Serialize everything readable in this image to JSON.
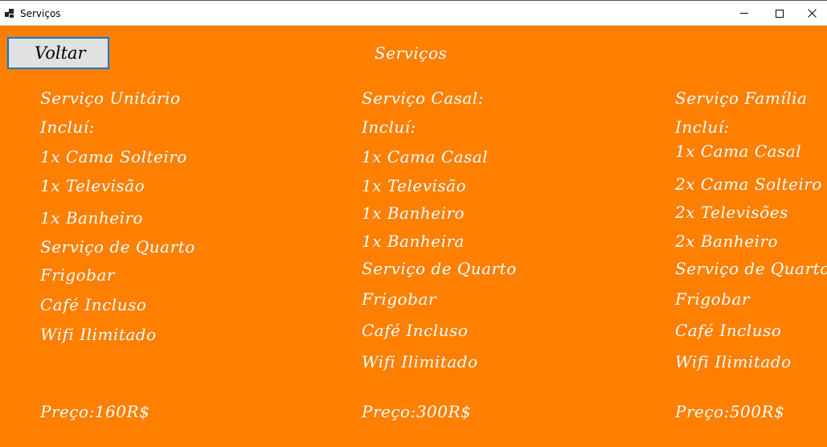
{
  "window": {
    "title": "Serviços"
  },
  "back_label": "Voltar",
  "page_title": "Serviços",
  "columns": [
    {
      "name": "Serviço Unitário",
      "includes_label": "Incluí:",
      "items": [
        "1x Cama Solteiro",
        "1x Televisão",
        "1x Banheiro",
        "Serviço de Quarto",
        "Frigobar",
        "Café Incluso",
        "Wifi Ilimitado"
      ],
      "price": "Preço:160R$"
    },
    {
      "name": "Serviço Casal:",
      "includes_label": "Incluí:",
      "items": [
        "1x Cama Casal",
        "1x Televisão",
        "1x Banheiro",
        "1x Banheira",
        "Serviço de Quarto",
        "Frigobar",
        "Café Incluso",
        "Wifi Ilimitado"
      ],
      "price": "Preço:300R$"
    },
    {
      "name": "Serviço Família",
      "includes_label": "Incluí:",
      "items": [
        "1x Cama Casal",
        "2x Cama Solteiro",
        "2x Televisões",
        "2x Banheiro",
        "Serviço de Quarto",
        "Frigobar",
        "Café Incluso",
        "Wifi Ilimitado"
      ],
      "price": "Preço:500R$"
    }
  ],
  "colors": {
    "background": "#ff7f00",
    "text": "#ffffff",
    "button_border": "#0078d7"
  }
}
